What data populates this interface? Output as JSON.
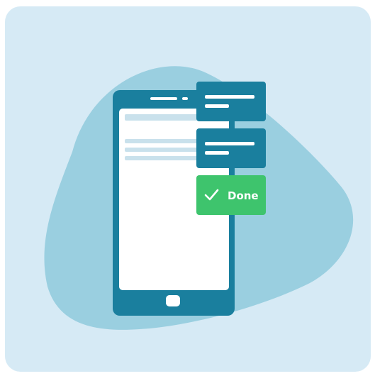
{
  "illustration": {
    "done_label": "Done",
    "icons": [
      "smartphone-icon",
      "home-button-icon",
      "message-card-icon",
      "checkmark-icon"
    ],
    "colors": {
      "card_background": "#d6eaf5",
      "blob": "#9acfe0",
      "phone_frame": "#1a7f9e",
      "phone_screen": "#ffffff",
      "screen_lines": "#c9e1ec",
      "message_card": "#1a7f9e",
      "done_button": "#3ec46d"
    }
  }
}
